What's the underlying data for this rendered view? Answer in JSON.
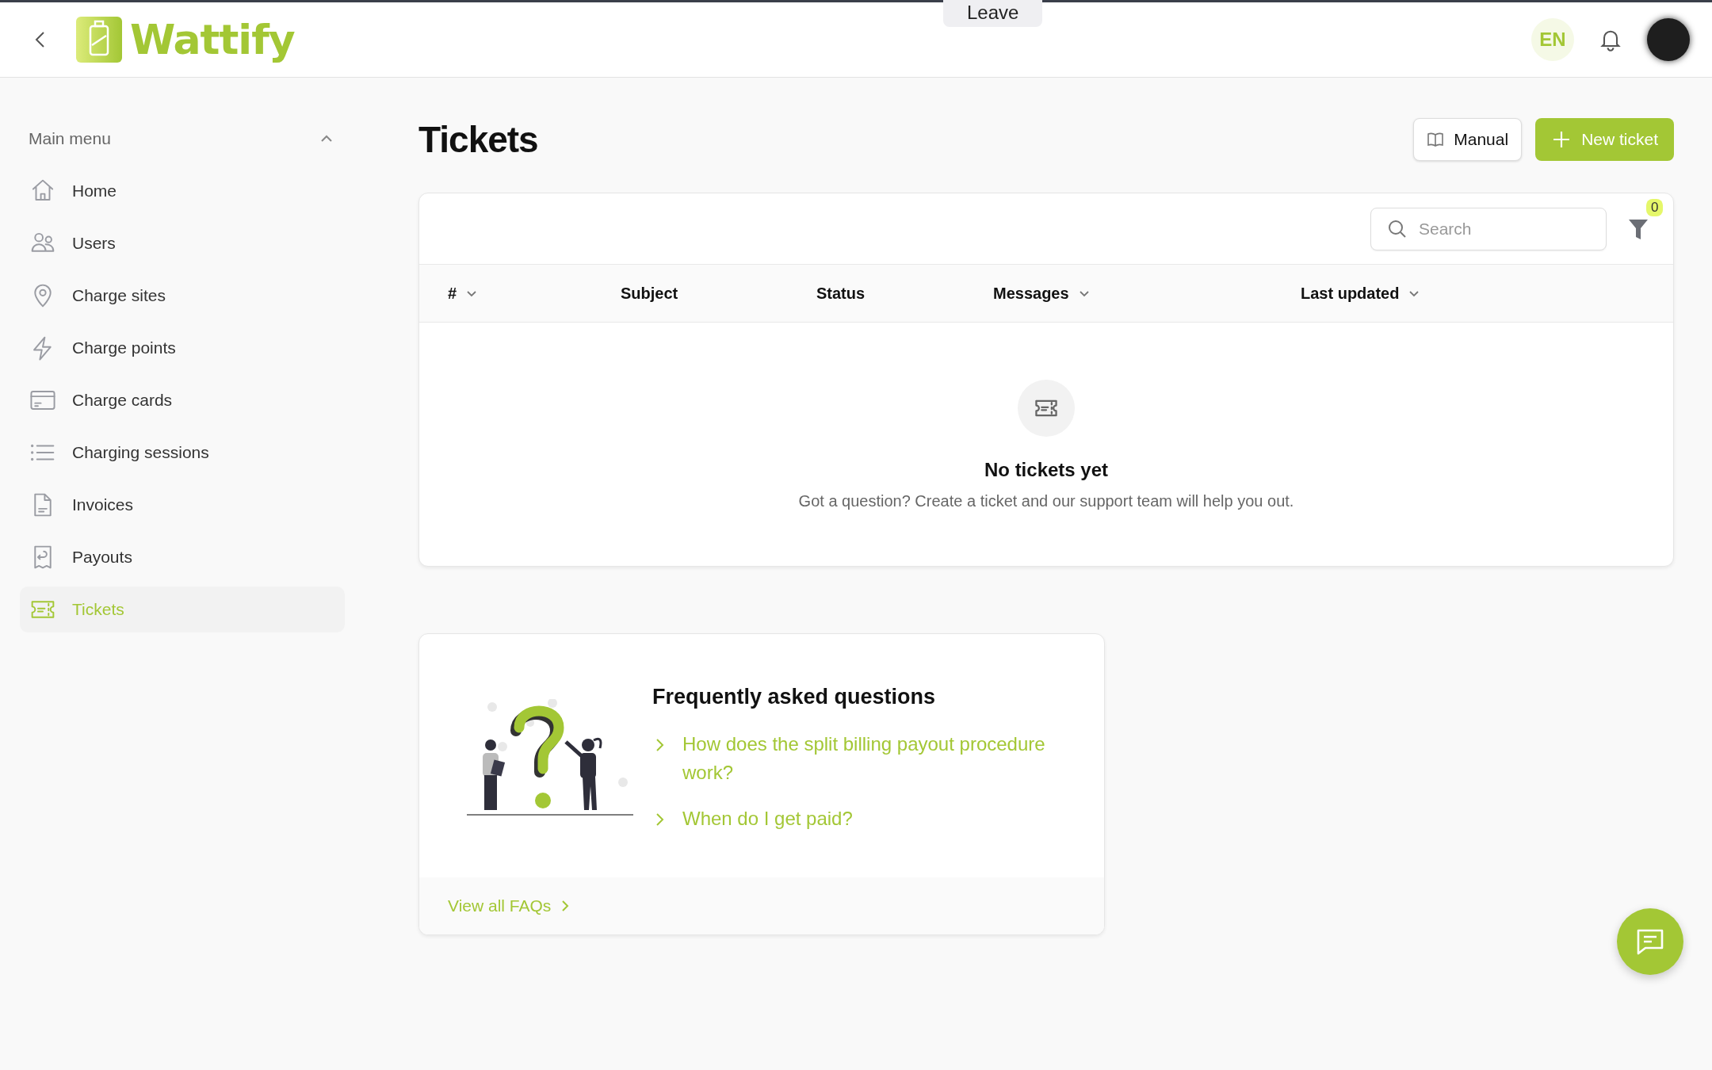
{
  "header": {
    "leave_button": "Leave",
    "brand": "Wattify",
    "language": "EN"
  },
  "sidebar": {
    "title": "Main menu",
    "expanded": true,
    "items": [
      {
        "label": "Home",
        "kind": "home",
        "selected": false
      },
      {
        "label": "Users",
        "kind": "users",
        "selected": false
      },
      {
        "label": "Charge sites",
        "kind": "pin",
        "selected": false
      },
      {
        "label": "Charge points",
        "kind": "bolt",
        "selected": false
      },
      {
        "label": "Charge cards",
        "kind": "card",
        "selected": false
      },
      {
        "label": "Charging sessions",
        "kind": "list",
        "selected": false
      },
      {
        "label": "Invoices",
        "kind": "document",
        "selected": false
      },
      {
        "label": "Payouts",
        "kind": "receipt",
        "selected": false
      },
      {
        "label": "Tickets",
        "kind": "ticket",
        "selected": true
      }
    ]
  },
  "page": {
    "title": "Tickets",
    "buttons": [
      {
        "label": "Manual",
        "kind": "secondary"
      },
      {
        "label": "New ticket",
        "kind": "primary"
      }
    ]
  },
  "table": {
    "search": {
      "placeholder": "Search"
    },
    "filter_count": "0",
    "columns": [
      {
        "label": "#",
        "sortable": true
      },
      {
        "label": "Subject",
        "sortable": false
      },
      {
        "label": "Status",
        "sortable": false
      },
      {
        "label": "Messages",
        "sortable": true
      },
      {
        "label": "Last updated",
        "sortable": true
      }
    ],
    "empty": {
      "title": "No tickets yet",
      "message": "Got a question? Create a ticket and our support team will help you out."
    }
  },
  "faq": {
    "title": "Frequently asked questions",
    "questions": [
      "How does the split billing payout procedure work?",
      "When do I get paid?"
    ],
    "link": "View all FAQs"
  }
}
